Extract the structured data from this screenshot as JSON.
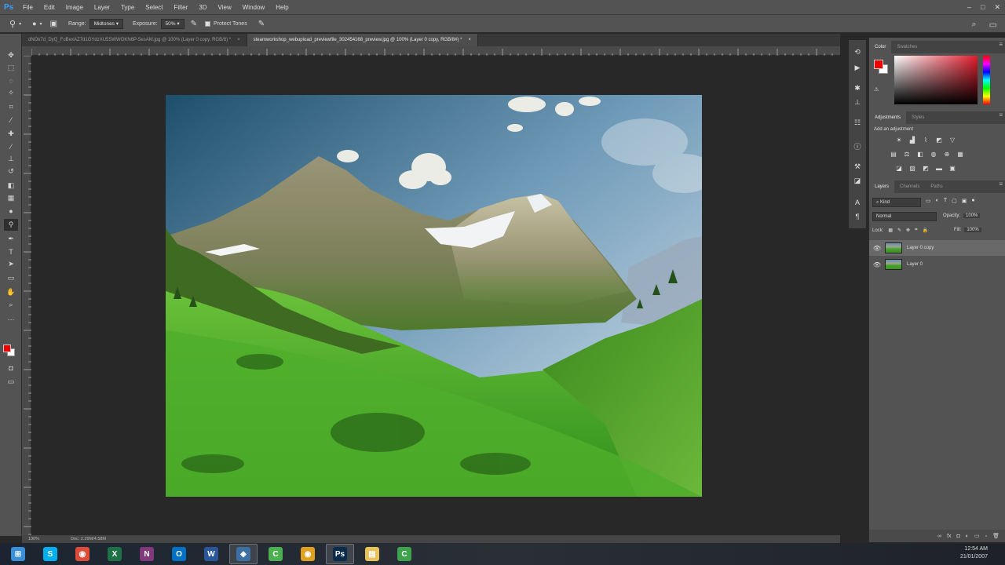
{
  "app": {
    "logo": "Ps",
    "window_controls": [
      "–",
      "□",
      "✕"
    ]
  },
  "menu": [
    "File",
    "Edit",
    "Image",
    "Layer",
    "Type",
    "Select",
    "Filter",
    "3D",
    "View",
    "Window",
    "Help"
  ],
  "options": {
    "range_label": "Range:",
    "range_value": "Midtones",
    "exposure_label": "Exposure:",
    "exposure_value": "50%",
    "protect_tones": "Protect Tones"
  },
  "doc_tabs": [
    {
      "label": "dNOk7d_DyQ_FoBexAZ7d1GYdzXU5SWWOKN6P-5esAM.jpg @ 100% (Layer 0 copy, RGB/8) *",
      "close": "×"
    },
    {
      "label": "steamworkshop_webupload_previewfile_302454168_preview.jpg @ 100% (Layer 0 copy, RGB/8#) *",
      "close": "×"
    }
  ],
  "status": {
    "zoom": "100%",
    "doc": "Doc: 2.29M/4.58M"
  },
  "panels": {
    "color_tabs": [
      "Color",
      "Swatches"
    ],
    "adjustments_tabs": [
      "Adjustments",
      "Styles"
    ],
    "add_adjustment": "Add an adjustment",
    "layers_tabs": [
      "Layers",
      "Channels",
      "Paths"
    ],
    "kind": "Kind",
    "blend_mode": "Normal",
    "opacity_label": "Opacity:",
    "opacity_value": "100%",
    "lock_label": "Lock:",
    "fill_label": "Fill:",
    "fill_value": "100%",
    "layers": [
      {
        "name": "Layer 0 copy",
        "selected": true
      },
      {
        "name": "Layer 0",
        "selected": false
      }
    ],
    "footer_icons": [
      "∞",
      "fx",
      "◘",
      "◐",
      "▭",
      "▫",
      "🗑"
    ]
  },
  "taskbar": {
    "apps": [
      {
        "icon": "windows-start-icon",
        "glyph": "⊞",
        "color": "#3a8fd9"
      },
      {
        "icon": "skype-icon",
        "glyph": "S",
        "color": "#00aff0"
      },
      {
        "icon": "chrome-icon",
        "glyph": "◉",
        "color": "#dd4b39"
      },
      {
        "icon": "excel-icon",
        "glyph": "X",
        "color": "#1e7145"
      },
      {
        "icon": "onenote-icon",
        "glyph": "N",
        "color": "#80397b"
      },
      {
        "icon": "outlook-icon",
        "glyph": "O",
        "color": "#0072c6"
      },
      {
        "icon": "word-icon",
        "glyph": "W",
        "color": "#2b579a"
      },
      {
        "icon": "network-app-icon",
        "glyph": "◈",
        "color": "#3d6fa0"
      },
      {
        "icon": "camtasia-icon",
        "glyph": "C",
        "color": "#4caf50"
      },
      {
        "icon": "chrome-alt-icon",
        "glyph": "◉",
        "color": "#e0a020"
      },
      {
        "icon": "photoshop-taskbar-icon",
        "glyph": "Ps",
        "color": "#0b2c4a"
      },
      {
        "icon": "file-explorer-icon",
        "glyph": "▤",
        "color": "#e8c25a"
      },
      {
        "icon": "camtasia-recorder-icon",
        "glyph": "C",
        "color": "#3fa34d"
      }
    ],
    "time": "12:54 AM",
    "date": "21/01/2007"
  }
}
